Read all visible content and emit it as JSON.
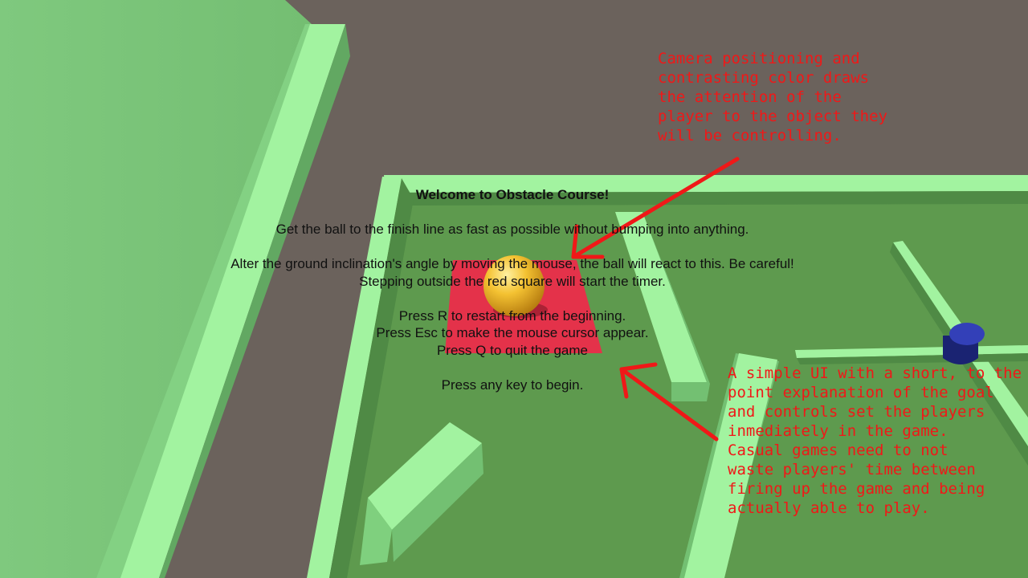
{
  "hud": {
    "title": "Welcome to Obstacle Course!",
    "goal": "Get the ball to the finish line as fast as possible without bumping into anything.",
    "controls_1": "Alter the ground inclination's angle by moving the mouse, the ball will react to this. Be careful!",
    "controls_2": "Stepping outside the red square will start the timer.",
    "restart": "Press R to restart from the beginning.",
    "cursor": "Press Esc to make the mouse cursor appear.",
    "quit": "Press Q to quit the game",
    "begin": "Press any key to begin."
  },
  "annotations": {
    "camera_lines": [
      "Camera positioning and",
      "contrasting color draws",
      "the attention of the",
      "player to the object they",
      "will be controlling."
    ],
    "ui_lines": [
      "A simple UI with a short, to the",
      "point explanation of the goal",
      "and controls set the players",
      "inmediately in the game.",
      "Casual games need to not",
      "waste players' time between",
      "firing up the game and being",
      "actually able to play."
    ]
  },
  "colors": {
    "background": "#6b625c",
    "floor": "#5e9a4e",
    "wall_top": "#a2f3a0",
    "wall_side": "#78c877",
    "start_square": "#e4324a",
    "ball": "#f2b62a",
    "cylinder": "#1f2a8c",
    "annotation": "#f01818"
  },
  "objects": {
    "ball": "player-ball",
    "start": "red-start-square",
    "obstacle": "blue-cylinder"
  }
}
